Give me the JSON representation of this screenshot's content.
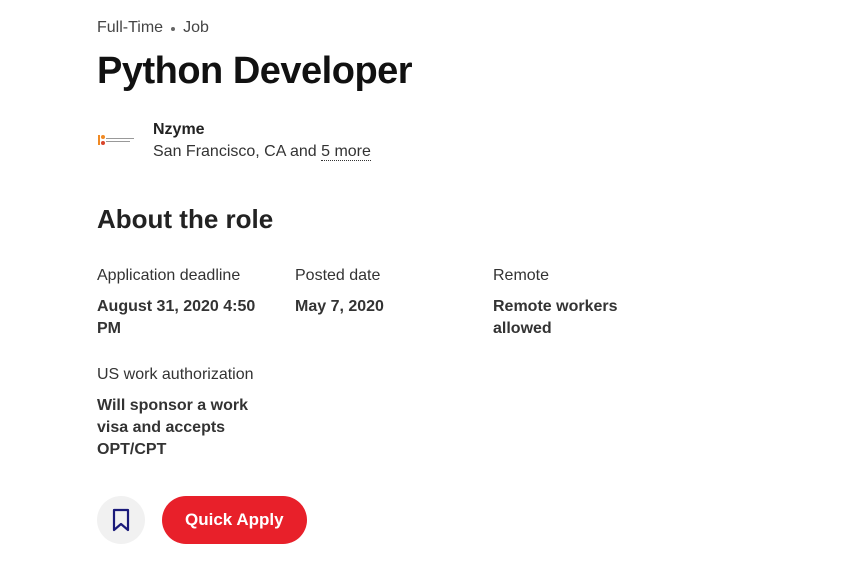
{
  "job": {
    "employment_type": "Full-Time",
    "posting_type": "Job",
    "title": "Python Developer"
  },
  "employer": {
    "name": "Nzyme",
    "logo_text": "Nzyme",
    "location": "San Francisco, CA",
    "location_joiner": "and",
    "more_locations_label": "5 more"
  },
  "about": {
    "heading": "About the role",
    "details": [
      {
        "label": "Application deadline",
        "value": "August 31, 2020 4:50 PM"
      },
      {
        "label": "Posted date",
        "value": "May 7, 2020"
      },
      {
        "label": "Remote",
        "value": "Remote workers allowed"
      },
      {
        "label": "US work authorization",
        "value": "Will sponsor a work visa and accepts OPT/CPT"
      }
    ]
  },
  "actions": {
    "save_icon": "bookmark-icon",
    "apply_label": "Quick Apply"
  },
  "colors": {
    "accent": "#e8202a",
    "bookmark": "#1a1a7a",
    "save_button_bg": "#f1f1f1"
  }
}
